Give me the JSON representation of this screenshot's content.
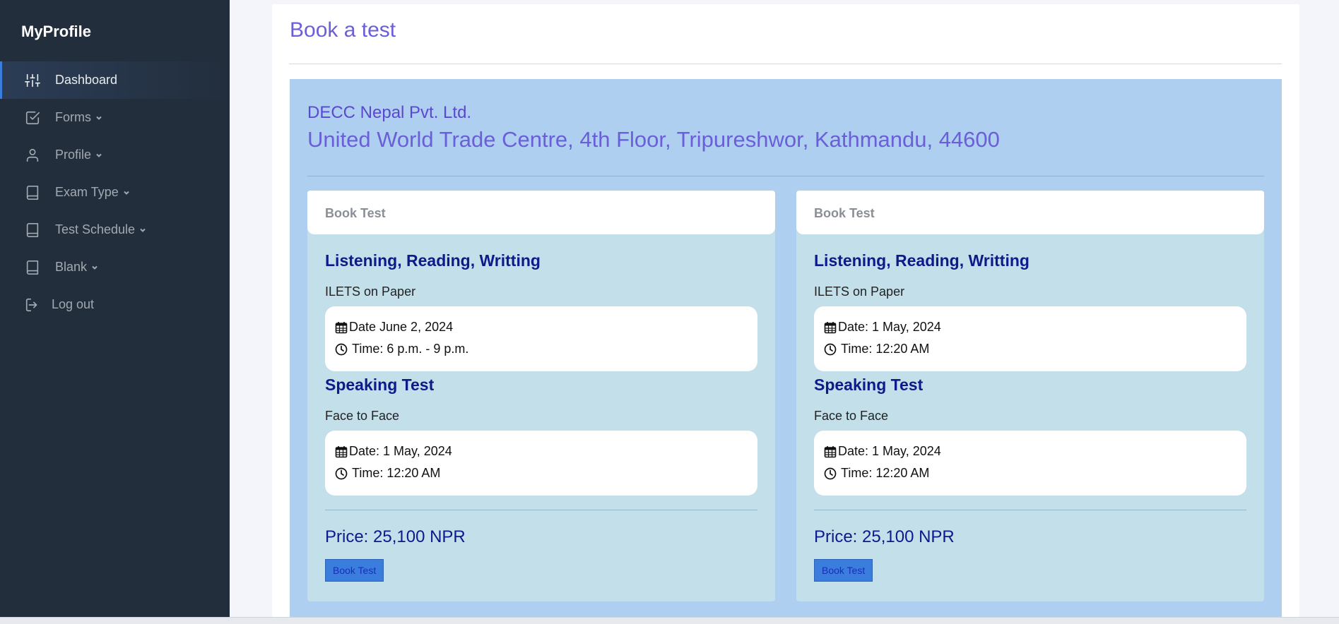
{
  "sidebar": {
    "brand": "MyProfile",
    "items": [
      {
        "label": "Dashboard",
        "icon": "sliders-icon",
        "active": true,
        "dropdown": false
      },
      {
        "label": "Forms",
        "icon": "check-square-icon",
        "active": false,
        "dropdown": true
      },
      {
        "label": "Profile",
        "icon": "user-icon",
        "active": false,
        "dropdown": true
      },
      {
        "label": "Exam Type",
        "icon": "book-icon",
        "active": false,
        "dropdown": true
      },
      {
        "label": "Test Schedule",
        "icon": "book-icon",
        "active": false,
        "dropdown": true
      },
      {
        "label": "Blank",
        "icon": "book-icon",
        "active": false,
        "dropdown": true
      },
      {
        "label": "Log out",
        "icon": "log-out-icon",
        "active": false,
        "dropdown": false
      }
    ]
  },
  "page": {
    "title": "Book a test"
  },
  "center": {
    "name": "DECC Nepal Pvt. Ltd.",
    "address": "United World Trade Centre, 4th Floor, Tripureshwor, Kathmandu, 44600"
  },
  "cards": [
    {
      "header": "Book Test",
      "written": {
        "title": "Listening, Reading, Writting",
        "mode": "ILETS on Paper",
        "date": "Date June 2, 2024",
        "time": "Time: 6 p.m. - 9 p.m."
      },
      "speaking": {
        "title": "Speaking Test",
        "mode": "Face to Face",
        "date": "Date: 1 May, 2024",
        "time": "Time: 12:20 AM"
      },
      "price": "Price: 25,100 NPR",
      "button": "Book Test"
    },
    {
      "header": "Book Test",
      "written": {
        "title": "Listening, Reading, Writting",
        "mode": "ILETS on Paper",
        "date": "Date: 1 May, 2024",
        "time": "Time: 12:20 AM"
      },
      "speaking": {
        "title": "Speaking Test",
        "mode": "Face to Face",
        "date": "Date: 1 May, 2024",
        "time": "Time: 12:20 AM"
      },
      "price": "Price: 25,100 NPR",
      "button": "Book Test"
    }
  ],
  "colors": {
    "sidebar_bg": "#222e3c",
    "accent": "#3b7ddd",
    "title": "#6a5fd9",
    "center_bg": "#aecff0",
    "card_bg": "#c3e0ea",
    "heading": "#0c1a8a"
  }
}
